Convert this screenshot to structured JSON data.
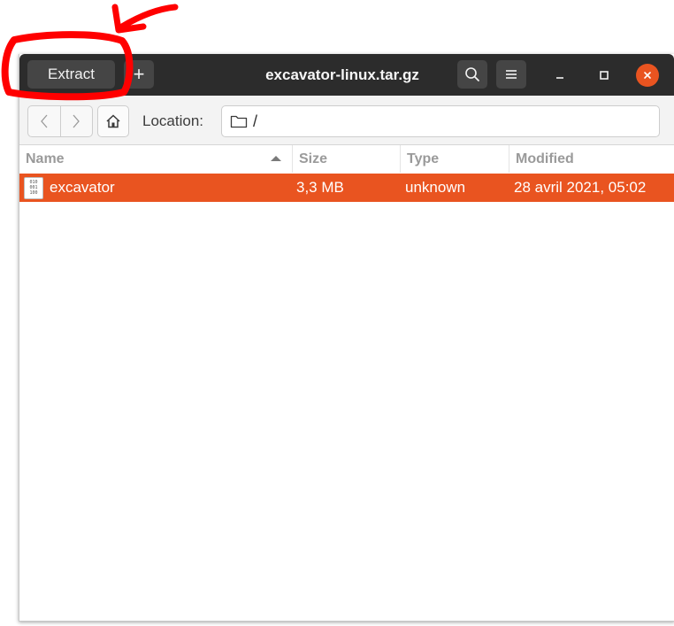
{
  "window": {
    "title": "excavator-linux.tar.gz"
  },
  "headerbar": {
    "extract_label": "Extract",
    "add_label": "+"
  },
  "toolbar": {
    "location_label": "Location:",
    "location_path": "/"
  },
  "columns": {
    "name": "Name",
    "size": "Size",
    "type": "Type",
    "modified": "Modified"
  },
  "files": [
    {
      "name": "excavator",
      "size": "3,3 MB",
      "type": "unknown",
      "modified": "28 avril 2021, 05:02",
      "selected": true,
      "icon": "binary-file-icon"
    }
  ],
  "colors": {
    "headerbar": "#2c2c2c",
    "selection": "#e95420",
    "close_button": "#e95420",
    "annotation": "#ff0000"
  },
  "annotation": {
    "type": "hand-drawn red circle and arrow highlighting the Extract button"
  }
}
